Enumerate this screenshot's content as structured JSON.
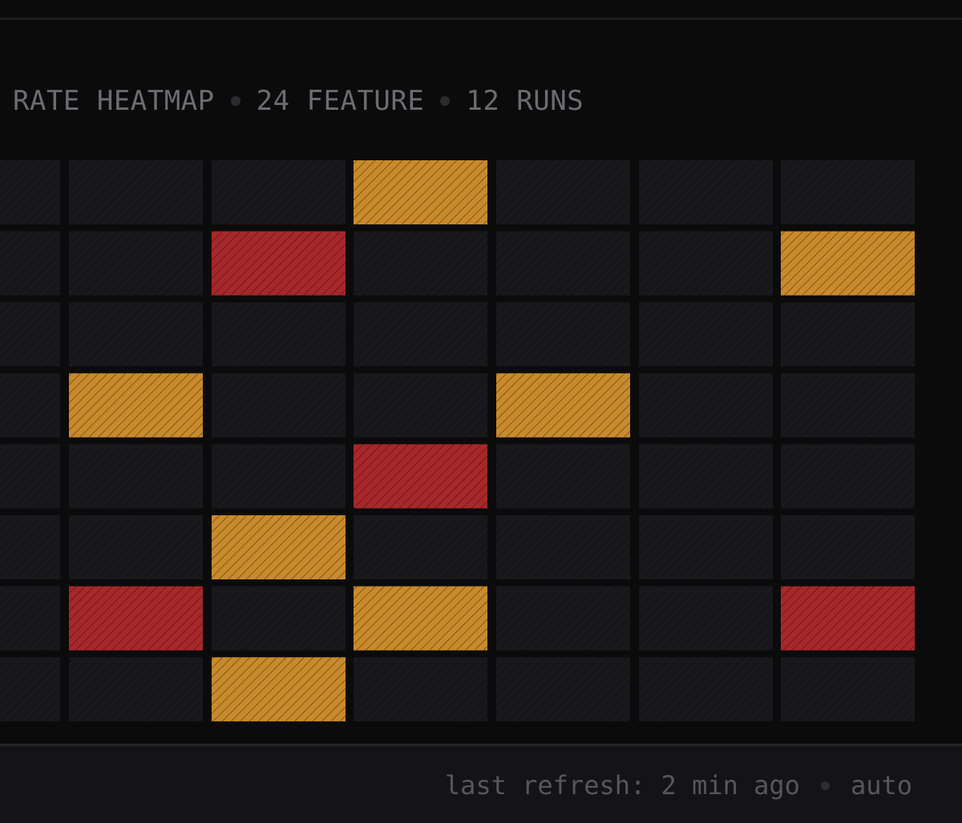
{
  "header": {
    "title_part1": "RATE HEATMAP",
    "title_part2": "24 FEATURE",
    "title_part3": "12 RUNS"
  },
  "footer": {
    "refresh_text": "last refresh: 2 min ago",
    "mode_text": "auto"
  },
  "colors": {
    "background": "#0b0b0c",
    "cell_empty": "#17171b",
    "cell_warn": "#c98a2c",
    "cell_fail": "#a8282a",
    "text_muted": "#6c6c72"
  },
  "chart_data": {
    "type": "heatmap",
    "title": "RATE HEATMAP • 24 FEATURE • 12 RUNS",
    "legend": [],
    "levels": [
      "none",
      "warn",
      "fail"
    ],
    "rows": 8,
    "columns": 7,
    "matrix": [
      [
        0,
        0,
        0,
        1,
        0,
        0,
        0
      ],
      [
        0,
        0,
        2,
        0,
        0,
        0,
        1
      ],
      [
        0,
        0,
        0,
        0,
        0,
        0,
        0
      ],
      [
        0,
        1,
        0,
        0,
        1,
        0,
        0
      ],
      [
        0,
        0,
        0,
        2,
        0,
        0,
        0
      ],
      [
        0,
        0,
        1,
        0,
        0,
        0,
        0
      ],
      [
        0,
        2,
        0,
        1,
        0,
        0,
        2
      ],
      [
        0,
        0,
        1,
        0,
        0,
        0,
        0
      ]
    ]
  }
}
